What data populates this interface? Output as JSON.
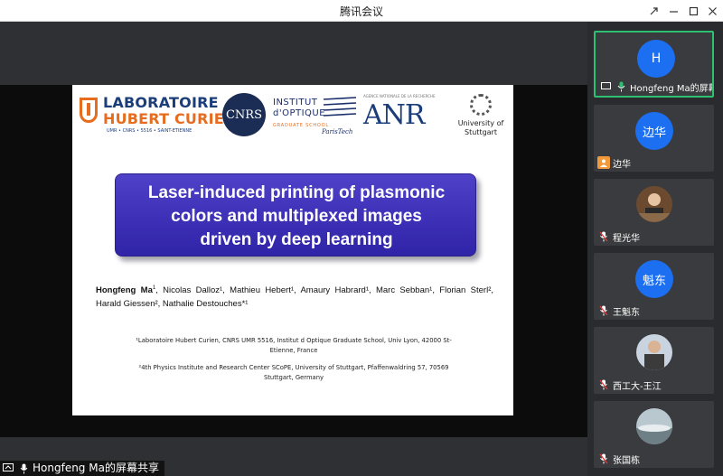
{
  "window": {
    "title": "腾讯会议"
  },
  "share": {
    "label": "Hongfeng Ma的屏幕共享"
  },
  "slide": {
    "logos": {
      "lhc_line1": "LABORATOIRE",
      "lhc_line2": "HUBERT CURIEN",
      "lhc_sub": "UMR • CNRS • 5516 • SAINT-ETIENNE",
      "cnrs": "CNRS",
      "io_line1": "INSTITUT",
      "io_line2": "d'OPTIQUE",
      "io_gs": "GRADUATE SCHOOL",
      "io_pt": "ParisTech",
      "anr": "ANR",
      "anr_top": "AGENCE NATIONALE DE LA RECHERCHE",
      "ust_line1": "University of",
      "ust_line2": "Stuttgart"
    },
    "title_line1": "Laser-induced printing of plasmonic",
    "title_line2": "colors and multiplexed images",
    "title_line3": "driven by deep learning",
    "authors": {
      "a1": "Hongfeng Ma",
      "a1_sup": "1",
      "rest": ", Nicolas Dalloz¹, Mathieu Hebert¹, Amaury Habrard¹, Marc Sebban¹, Florian Sterl², Harald Giessen², Nathalie Destouches*¹"
    },
    "aff1_line1": "¹Laboratoire Hubert Curien, CNRS UMR 5516, Institut d Optique Graduate School, Univ Lyon, 42000 St-",
    "aff1_line2": "Etienne, France",
    "aff2_line1": "²4th Physics Institute and Research Center SCoPE, University of Stuttgart, Pfaffenwaldring 57, 70569",
    "aff2_line2": "Stuttgart, Germany"
  },
  "participants": [
    {
      "name": "Hongfeng Ma的屏幕...",
      "avatar_text": "H",
      "active": true,
      "status_icon": "screen-share-icon",
      "mic": "mic-on-icon"
    },
    {
      "name": "边华",
      "avatar_text": "边华",
      "status_icon": "person-icon"
    },
    {
      "name": "程光华",
      "photo": true,
      "mic": "mic-muted-icon"
    },
    {
      "name": "王魁东",
      "avatar_text": "魁东",
      "mic": "mic-muted-icon"
    },
    {
      "name": "西工大-王江",
      "photo": true,
      "mic": "mic-muted-icon"
    },
    {
      "name": "张国栋",
      "photo": true,
      "mic": "mic-muted-icon"
    }
  ],
  "colors": {
    "accent": "#1c6ff0",
    "active_border": "#2fbf71",
    "title_box": "#3a2eb8",
    "lhc_orange": "#e66d1f",
    "lhc_blue": "#1b3d7a"
  }
}
